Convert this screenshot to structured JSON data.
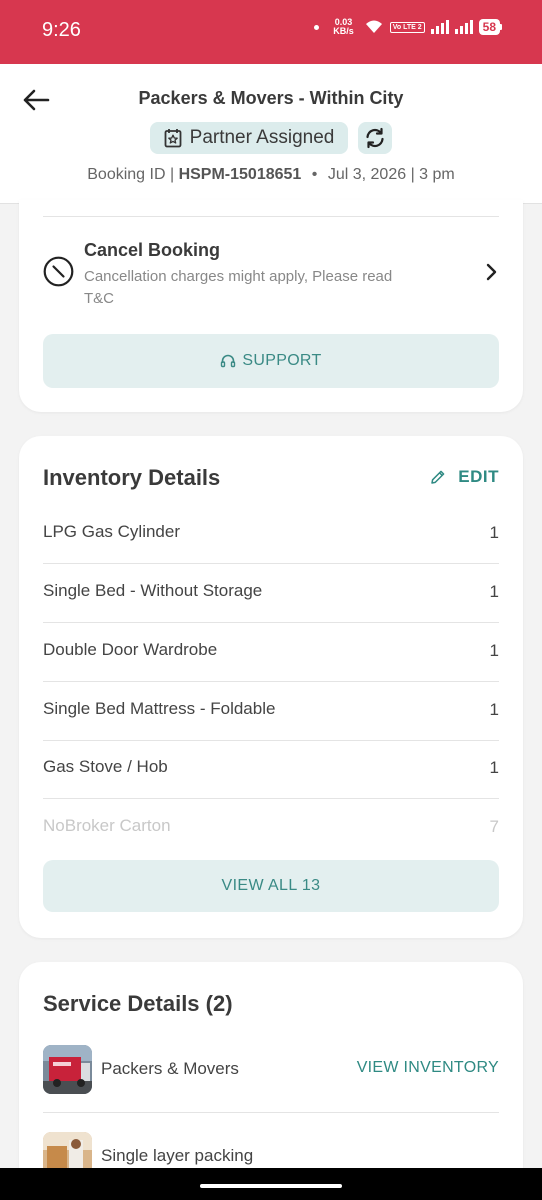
{
  "status_bar": {
    "time": "9:26",
    "net_speed_value": "0.03",
    "net_speed_unit": "KB/s",
    "volte_label": "Vo LTE 2",
    "battery": "58"
  },
  "header": {
    "title": "Packers & Movers - Within City",
    "status": "Partner Assigned",
    "booking_label": "Booking ID |",
    "booking_id": "HSPM-15018651",
    "separator": "•",
    "schedule": "Jul 3, 2026 | 3 pm"
  },
  "cancel": {
    "title": "Cancel Booking",
    "subtitle": "Cancellation charges might apply, Please read T&C"
  },
  "support": {
    "label": "SUPPORT"
  },
  "inventory": {
    "title": "Inventory Details",
    "edit_label": "EDIT",
    "items": [
      {
        "name": "LPG Gas Cylinder",
        "qty": "1"
      },
      {
        "name": "Single Bed - Without Storage",
        "qty": "1"
      },
      {
        "name": "Double Door Wardrobe",
        "qty": "1"
      },
      {
        "name": "Single Bed Mattress - Foldable",
        "qty": "1"
      },
      {
        "name": "Gas Stove / Hob",
        "qty": "1"
      },
      {
        "name": "NoBroker Carton",
        "qty": "7"
      }
    ],
    "view_all_label": "VIEW ALL 13"
  },
  "services": {
    "title": "Service Details (2)",
    "items": [
      {
        "name": "Packers & Movers",
        "action": "VIEW INVENTORY"
      },
      {
        "name": "Single layer packing",
        "action": ""
      }
    ]
  },
  "colors": {
    "brand_red": "#d7374f",
    "accent_teal": "#2f8a83",
    "pill_bg": "#dcecec"
  }
}
